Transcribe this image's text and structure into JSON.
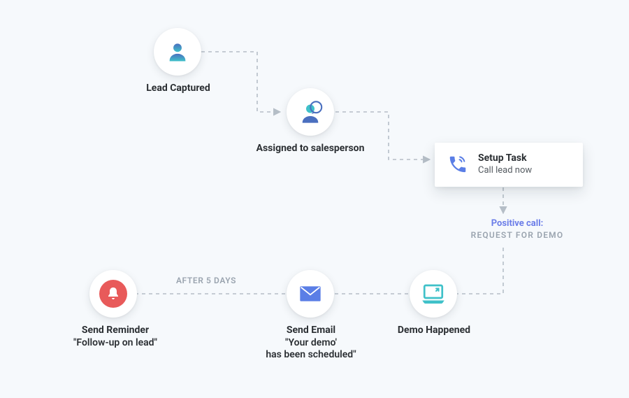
{
  "nodes": {
    "lead_captured": {
      "label": "Lead Captured"
    },
    "assigned": {
      "label": "Assigned to salesperson"
    },
    "setup_task": {
      "title": "Setup Task",
      "subtitle": "Call lead now"
    },
    "demo_happened": {
      "label": "Demo Happened"
    },
    "send_email": {
      "label1": "Send Email",
      "label2": "\"Your demo'",
      "label3": "has been scheduled\""
    },
    "send_reminder": {
      "label1": "Send Reminder",
      "label2": "\"Follow-up on lead\""
    }
  },
  "edges": {
    "positive_call": {
      "line1": "Positive call:",
      "line2": "REQUEST FOR DEMO"
    },
    "after_5_days": {
      "text": "AFTER 5 DAYS"
    }
  },
  "colors": {
    "teal": "#3fc1c9",
    "red": "#e85a5a",
    "blue": "#5a7ee6",
    "grey": "#b5bec7",
    "link": "#6b7de8"
  }
}
